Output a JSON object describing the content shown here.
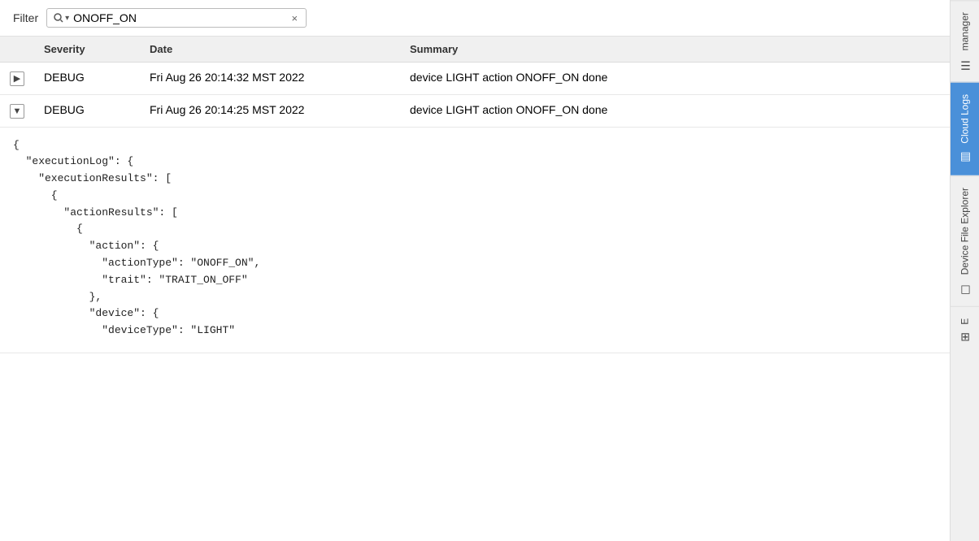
{
  "filter": {
    "label": "Filter",
    "placeholder": "ONOFF_ON",
    "value": "ONOFF_ON",
    "icon": "🔍▾",
    "clear_label": "×"
  },
  "table": {
    "columns": [
      {
        "key": "expand",
        "label": ""
      },
      {
        "key": "severity",
        "label": "Severity"
      },
      {
        "key": "date",
        "label": "Date"
      },
      {
        "key": "summary",
        "label": "Summary"
      }
    ],
    "rows": [
      {
        "id": "row1",
        "expanded": false,
        "expand_icon": "▶",
        "severity": "DEBUG",
        "date": "Fri Aug 26 20:14:32 MST 2022",
        "summary": "device LIGHT action ONOFF_ON done"
      },
      {
        "id": "row2",
        "expanded": true,
        "expand_icon": "▼",
        "severity": "DEBUG",
        "date": "Fri Aug 26 20:14:25 MST 2022",
        "summary": "device LIGHT action ONOFF_ON done",
        "json_detail": "{\n  \"executionLog\": {\n    \"executionResults\": [\n      {\n        \"actionResults\": [\n          {\n            \"action\": {\n              \"actionType\": \"ONOFF_ON\",\n              \"trait\": \"TRAIT_ON_OFF\"\n            },\n            \"device\": {\n              \"deviceType\": \"LIGHT\""
      }
    ]
  },
  "sidebar": {
    "tabs": [
      {
        "id": "manager",
        "label": "manager",
        "icon": "☰",
        "active": false
      },
      {
        "id": "cloud-logs",
        "label": "Cloud Logs",
        "icon": "▤",
        "active": true
      },
      {
        "id": "device-file-explorer",
        "label": "Device File Explorer",
        "icon": "☐",
        "active": false
      },
      {
        "id": "extra",
        "label": "E",
        "icon": "⊞",
        "active": false
      }
    ]
  }
}
